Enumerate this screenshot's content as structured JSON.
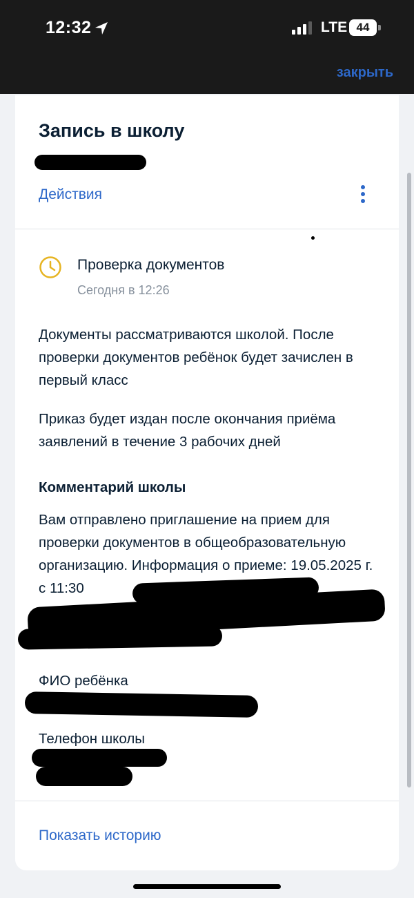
{
  "status_bar": {
    "time": "12:32",
    "network": "LTE",
    "battery": "44",
    "icons": [
      "location-arrow-icon",
      "signal-icon",
      "battery-icon"
    ]
  },
  "header": {
    "close_label": "закрыть"
  },
  "card": {
    "title": "Запись в школу",
    "actions_label": "Действия",
    "status": {
      "title": "Проверка документов",
      "time": "Сегодня в 12:26"
    },
    "paragraph1": "Документы рассматриваются школой. После проверки документов ребёнок будет зачислен в первый класс",
    "paragraph2": "Приказ будет издан после окончания приёма заявлений в течение 3 рабочих дней",
    "comment_title": "Комментарий школы",
    "comment_text": "Вам отправлено приглашение на прием для проверки документов в общеобразовательную организацию. Информация о приеме: 19.05.2025 г. с 11:30",
    "child_label": "ФИО ребёнка",
    "phone_label": "Телефон школы",
    "history_label": "Показать историю"
  },
  "colors": {
    "accent": "#2d68c9",
    "status_icon": "#e6b422",
    "text": "#0b1f33",
    "muted": "#86909c"
  }
}
